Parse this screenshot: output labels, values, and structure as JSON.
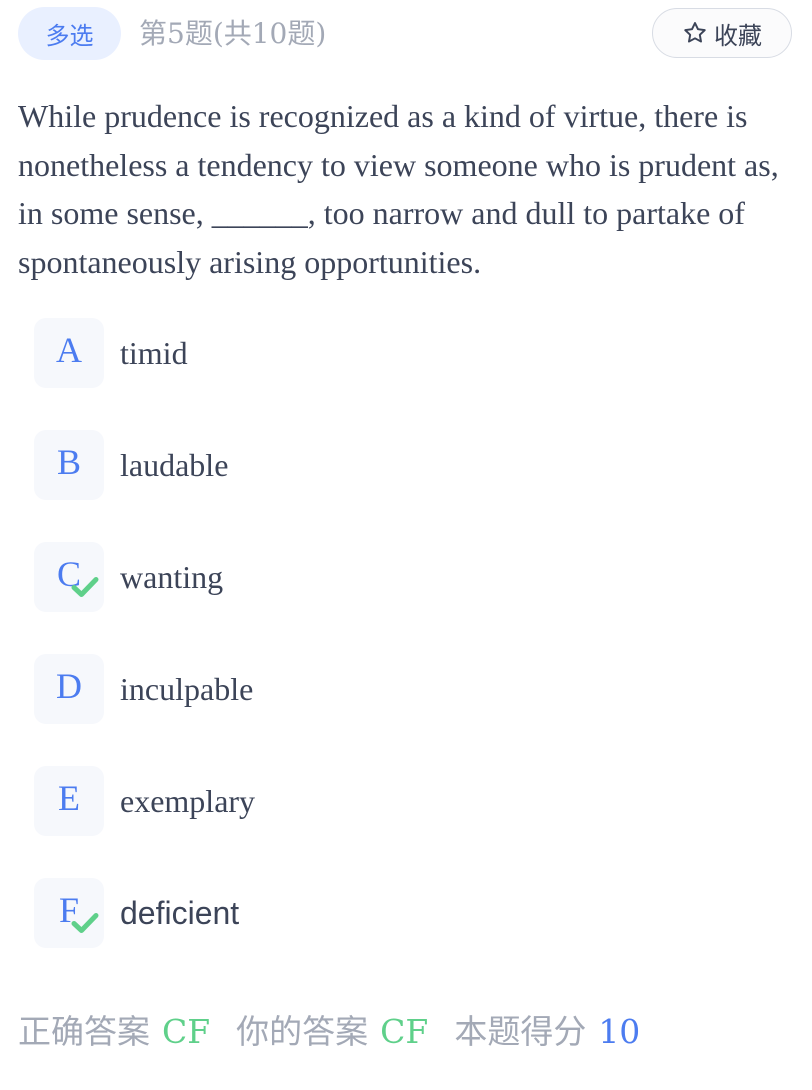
{
  "header": {
    "type_badge": "多选",
    "progress": "第5题(共10题)",
    "favorite_label": "收藏",
    "favorite_icon": "star-outline-icon"
  },
  "question": {
    "text": "While prudence is recognized as a kind of virtue, there is nonetheless a tendency to view someone who is prudent as, in some sense, ______, too narrow and dull to partake of spontaneously arising opportunities."
  },
  "options": [
    {
      "letter": "A",
      "text": "timid",
      "checked": false
    },
    {
      "letter": "B",
      "text": "laudable",
      "checked": false
    },
    {
      "letter": "C",
      "text": "wanting",
      "checked": true
    },
    {
      "letter": "D",
      "text": "inculpable",
      "checked": false
    },
    {
      "letter": "E",
      "text": "exemplary",
      "checked": false
    },
    {
      "letter": "F",
      "text": "deficient",
      "checked": true
    }
  ],
  "result": {
    "correct_label": "正确答案",
    "correct_value": "CF",
    "your_label": "你的答案",
    "your_value": "CF",
    "score_label": "本题得分",
    "score_value": "10"
  },
  "colors": {
    "accent": "#4c7cf0",
    "correct": "#5fd08a",
    "muted": "#a3a9b6",
    "text": "#3c4458"
  }
}
